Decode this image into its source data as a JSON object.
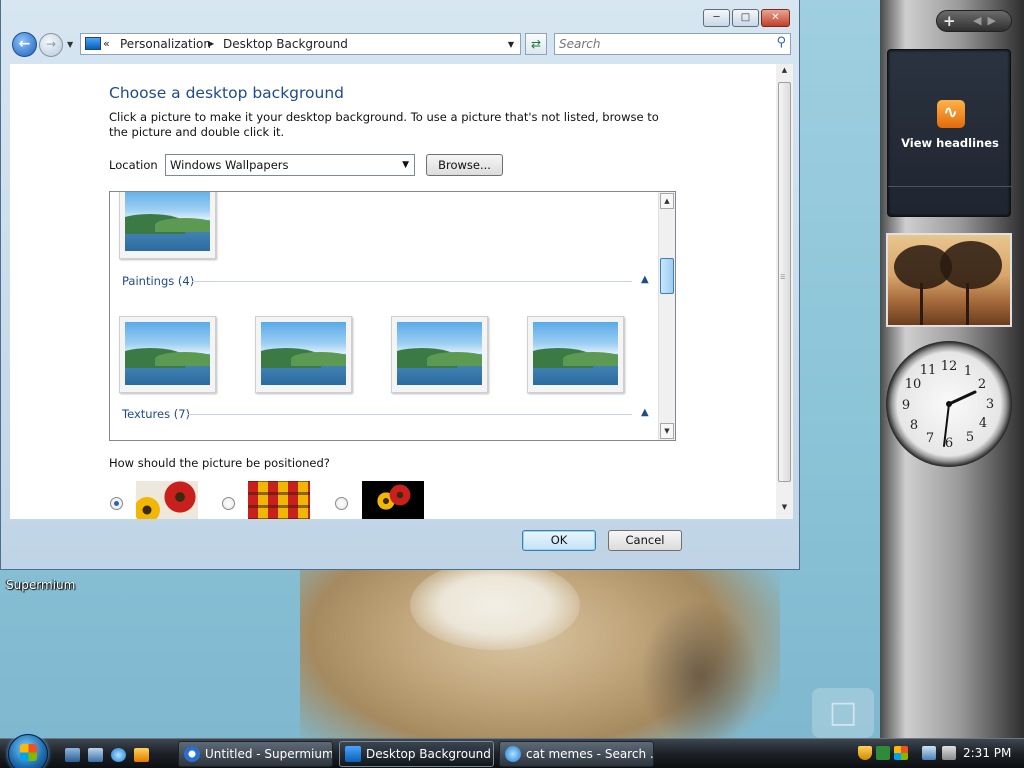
{
  "window": {
    "address": {
      "parent": "Personalization",
      "current": "Desktop Background"
    },
    "search": {
      "placeholder": "Search"
    },
    "title": "Choose a desktop background",
    "description": "Click a picture to make it your desktop background. To use a picture that's not listed, browse to the picture and double click it.",
    "location": {
      "label": "Location",
      "value": "Windows Wallpapers",
      "browse_label": "Browse..."
    },
    "groups": [
      {
        "label": "Paintings (4)"
      },
      {
        "label": "Textures (7)"
      }
    ],
    "position": {
      "label": "How should the picture be positioned?",
      "options": [
        "fit-to-screen",
        "tile",
        "center"
      ],
      "selected": 0
    },
    "buttons": {
      "ok": "OK",
      "cancel": "Cancel"
    }
  },
  "desktop": {
    "icon_label": "Supermium",
    "gadgets": {
      "feed_label": "View headlines"
    }
  },
  "taskbar": {
    "tasks": [
      {
        "label": "Untitled - Supermium",
        "active": false
      },
      {
        "label": "Desktop Background",
        "active": true
      },
      {
        "label": "cat memes - Search ...",
        "active": false
      }
    ],
    "clock": "2:31 PM"
  }
}
